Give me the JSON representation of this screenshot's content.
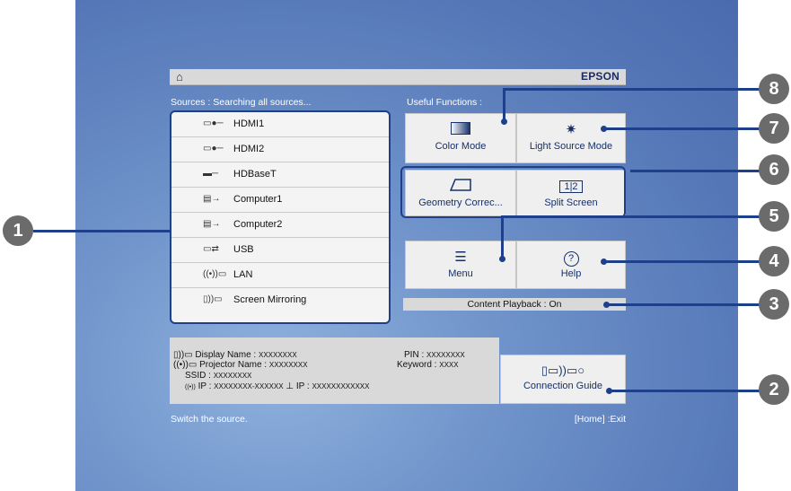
{
  "header": {
    "home_icon": "home-icon",
    "brand": "EPSON"
  },
  "sources": {
    "title": "Sources : Searching all sources...",
    "items": [
      {
        "icon": "▭●─",
        "label": "HDMI1"
      },
      {
        "icon": "▭●─",
        "label": "HDMI2"
      },
      {
        "icon": "▬─",
        "label": "HDBaseT"
      },
      {
        "icon": "▤→",
        "label": "Computer1"
      },
      {
        "icon": "▤→",
        "label": "Computer2"
      },
      {
        "icon": "▭⇄",
        "label": "USB"
      },
      {
        "icon": "((•))▭",
        "label": "LAN"
      },
      {
        "icon": "▯))▭",
        "label": "Screen Mirroring"
      }
    ]
  },
  "functions": {
    "title": "Useful Functions :",
    "color_mode": "Color Mode",
    "light_source_mode": "Light Source Mode",
    "geometry_correction": "Geometry Correc...",
    "split_screen": "Split Screen",
    "split_screen_icon": "1|2",
    "menu": "Menu",
    "help": "Help",
    "help_icon": "?",
    "content_playback": "Content Playback : On"
  },
  "network": {
    "display_name_label": "Display Name :",
    "display_name_value": "XXXXXXXX",
    "projector_name_label": "Projector Name :",
    "projector_name_value": "XXXXXXXX",
    "ssid_label": "SSID :",
    "ssid_value": "XXXXXXXX",
    "ip1_label": "IP :",
    "ip1_value": "XXXXXXXX-XXXXXX",
    "ip2_label": "IP :",
    "ip2_value": "XXXXXXXXXXXX",
    "pin_label": "PIN :",
    "pin_value": "XXXXXXXX",
    "keyword_label": "Keyword :",
    "keyword_value": "XXXX"
  },
  "connection_guide": "Connection Guide",
  "status": {
    "message": "Switch the source.",
    "exit_hint": "[Home] :Exit"
  },
  "callouts": [
    "1",
    "2",
    "3",
    "4",
    "5",
    "6",
    "7",
    "8"
  ],
  "colors": {
    "accent": "#1e3f8a",
    "screen_bg": "#5f83c2",
    "callout": "#6b6b6b",
    "panel": "#d9d9d9"
  }
}
